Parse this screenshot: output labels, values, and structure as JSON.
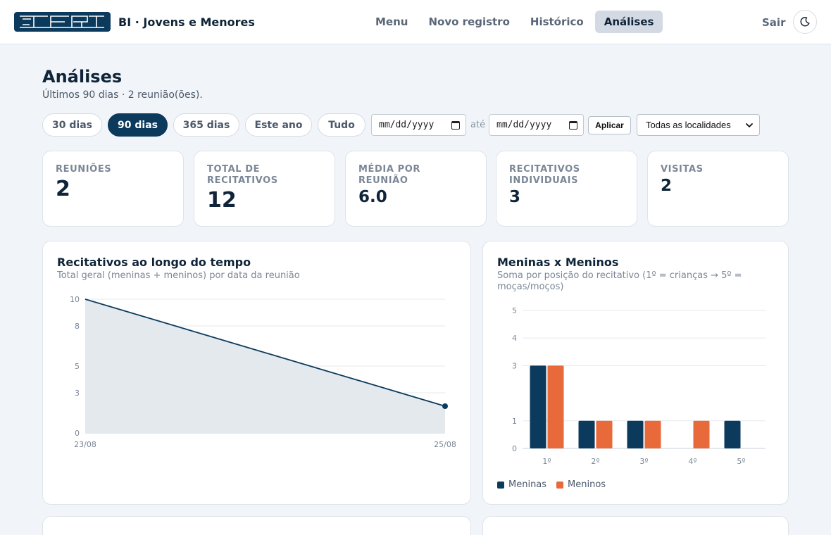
{
  "header": {
    "app_title": "BI · Jovens e Menores",
    "nav": [
      {
        "label": "Menu",
        "active": false
      },
      {
        "label": "Novo registro",
        "active": false
      },
      {
        "label": "Histórico",
        "active": false
      },
      {
        "label": "Análises",
        "active": true
      }
    ],
    "logout_label": "Sair",
    "theme_icon": "moon-icon"
  },
  "page": {
    "title": "Análises",
    "subtitle": "Últimos 90 dias · 2 reunião(ões)."
  },
  "filters": {
    "ranges": [
      {
        "label": "30 dias",
        "active": false
      },
      {
        "label": "90 dias",
        "active": true
      },
      {
        "label": "365 dias",
        "active": false
      },
      {
        "label": "Este ano",
        "active": false
      },
      {
        "label": "Tudo",
        "active": false
      }
    ],
    "date_from_placeholder": "mm/dd/yyyy",
    "separator": "até",
    "date_to_placeholder": "mm/dd/yyyy",
    "apply_label": "Aplicar",
    "location_selected": "Todas as localidades"
  },
  "kpis": [
    {
      "label": "Reuniões",
      "value": "2"
    },
    {
      "label": "Total de recitativos",
      "value": "12"
    },
    {
      "label": "Média por reunião",
      "value": "6.0"
    },
    {
      "label": "Recitativos individuais",
      "value": "3"
    },
    {
      "label": "Visitas",
      "value": "2"
    }
  ],
  "colors": {
    "primary": "#0b3a5c",
    "accent": "#e8693a",
    "area_fill": "#e4e9ee"
  },
  "charts": {
    "timeline": {
      "title": "Recitativos ao longo do tempo",
      "subtitle": "Total geral (meninas + meninos) por data da reunião"
    },
    "gender": {
      "title": "Meninas x Meninos",
      "subtitle": "Soma por posição do recitativo (1º = crianças → 5º = moças/moços)"
    }
  },
  "chart_data": [
    {
      "type": "area",
      "x": [
        "23/08",
        "25/08"
      ],
      "y": [
        10,
        2
      ],
      "title": "Recitativos ao longo do tempo",
      "subtitle": "Total geral (meninas + meninos) por data da reunião",
      "xlabel": "",
      "ylabel": "",
      "y_ticks": [
        0,
        3,
        5,
        8,
        10
      ],
      "ylim": [
        0,
        10
      ],
      "grid": true
    },
    {
      "type": "bar",
      "categories": [
        "1º",
        "2º",
        "3º",
        "4º",
        "5º"
      ],
      "series": [
        {
          "name": "Meninas",
          "values": [
            3,
            1,
            1,
            0,
            1
          ],
          "color": "#0b3a5c"
        },
        {
          "name": "Meninos",
          "values": [
            3,
            1,
            1,
            1,
            0
          ],
          "color": "#e8693a"
        }
      ],
      "title": "Meninas x Meninos",
      "subtitle": "Soma por posição do recitativo (1º = crianças → 5º = moças/moços)",
      "xlabel": "",
      "ylabel": "",
      "y_ticks": [
        0,
        1,
        3,
        4,
        5
      ],
      "ylim": [
        0,
        5
      ],
      "grid": true,
      "legend": "bottom-left"
    }
  ]
}
